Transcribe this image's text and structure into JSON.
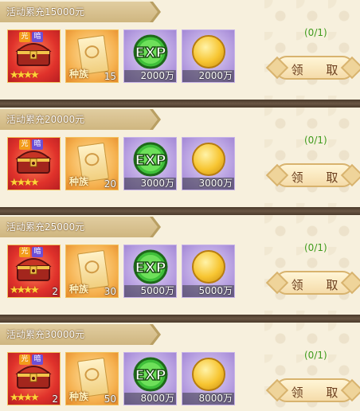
{
  "rows": [
    {
      "title": "活动累充15000元",
      "status": "(0/1)",
      "button": "领 取",
      "items": [
        {
          "name": "宝箱",
          "tag1": "光",
          "tag2": "暗",
          "stars": "★★★★",
          "qty": ""
        },
        {
          "name": "种族",
          "qty": "15"
        },
        {
          "name": "EXP",
          "qty": "2000万"
        },
        {
          "name": "金币",
          "qty": "2000万"
        }
      ]
    },
    {
      "title": "活动累充20000元",
      "status": "(0/1)",
      "button": "领 取",
      "items": [
        {
          "name": "宝箱",
          "tag1": "光",
          "tag2": "暗",
          "stars": "★★★★",
          "qty": ""
        },
        {
          "name": "种族",
          "qty": "20"
        },
        {
          "name": "EXP",
          "qty": "3000万"
        },
        {
          "name": "金币",
          "qty": "3000万"
        }
      ]
    },
    {
      "title": "活动累充25000元",
      "status": "(0/1)",
      "button": "领 取",
      "items": [
        {
          "name": "宝箱",
          "tag1": "光",
          "tag2": "暗",
          "stars": "★★★★",
          "qty": "2"
        },
        {
          "name": "种族",
          "qty": "30"
        },
        {
          "name": "EXP",
          "qty": "5000万"
        },
        {
          "name": "金币",
          "qty": "5000万"
        }
      ]
    },
    {
      "title": "活动累充30000元",
      "status": "(0/1)",
      "button": "领 取",
      "items": [
        {
          "name": "宝箱",
          "tag1": "光",
          "tag2": "暗",
          "stars": "★★★★",
          "qty": "2"
        },
        {
          "name": "种族",
          "qty": "50"
        },
        {
          "name": "EXP",
          "qty": "8000万"
        },
        {
          "name": "金币",
          "qty": "8000万"
        }
      ]
    }
  ],
  "seed_label": "种族",
  "exp_label": "EXP"
}
